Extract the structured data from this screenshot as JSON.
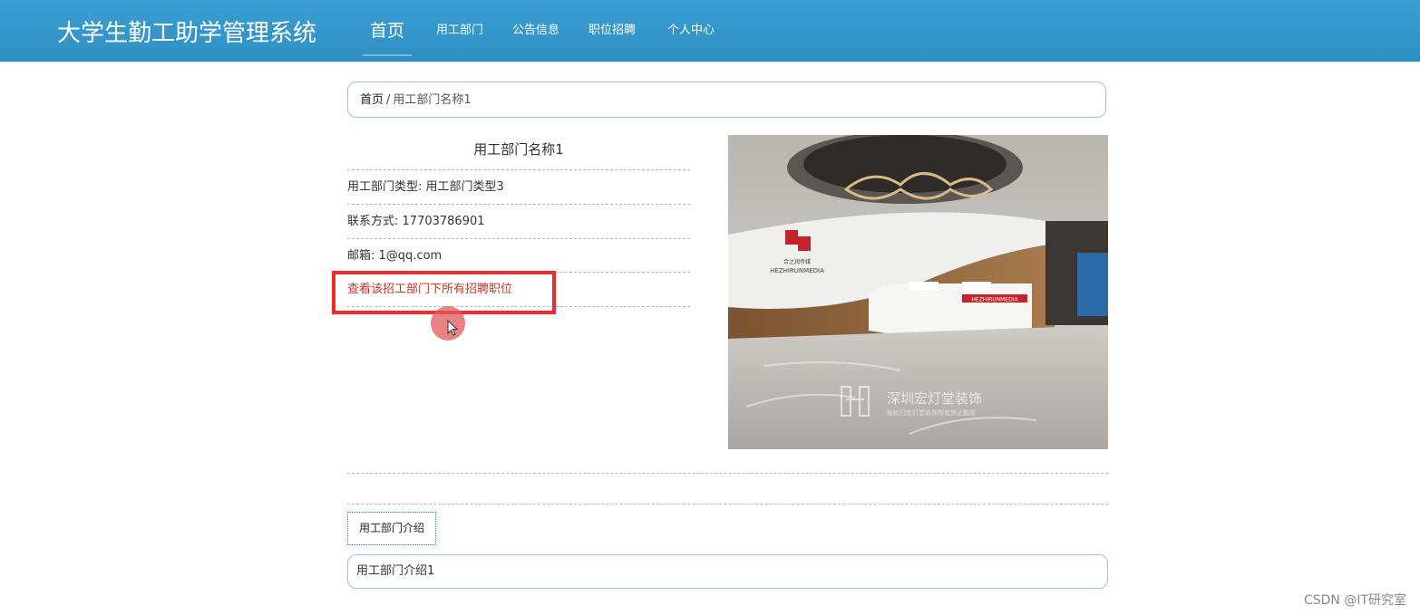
{
  "header": {
    "brand": "大学生勤工助学管理系统",
    "nav": [
      {
        "label": "首页",
        "active": true
      },
      {
        "label": "用工部门",
        "active": false
      },
      {
        "label": "公告信息",
        "active": false
      },
      {
        "label": "职位招聘",
        "active": false
      },
      {
        "label": "个人中心",
        "active": false
      }
    ]
  },
  "breadcrumb": {
    "home": "首页",
    "separator": "/",
    "current": "用工部门名称1"
  },
  "detail": {
    "title": "用工部门名称1",
    "type_label": "用工部门类型:",
    "type_value": "用工部门类型3",
    "phone_label": "联系方式:",
    "phone_value": "17703786901",
    "email_label": "邮箱:",
    "email_value": "1@qq.com",
    "jobs_link": "查看该招工部门下所有招聘职位"
  },
  "photo": {
    "sign_text": "HEZHIRUNMEDIA",
    "sign_cn": "合之润传媒",
    "desk_sign": "HEZHIRUNMEDIA",
    "watermark_cn": "深圳宏灯堂装饰",
    "watermark_sub": "版权归宏灯堂装饰所有禁止翻用"
  },
  "intro": {
    "tab_label": "用工部门介绍",
    "content": "用工部门介绍1"
  },
  "footer": {
    "watermark": "CSDN @IT研究室"
  },
  "colors": {
    "header_bg": "#2f8fc3",
    "link": "#c0392b",
    "highlight": "#ef2b2b"
  }
}
